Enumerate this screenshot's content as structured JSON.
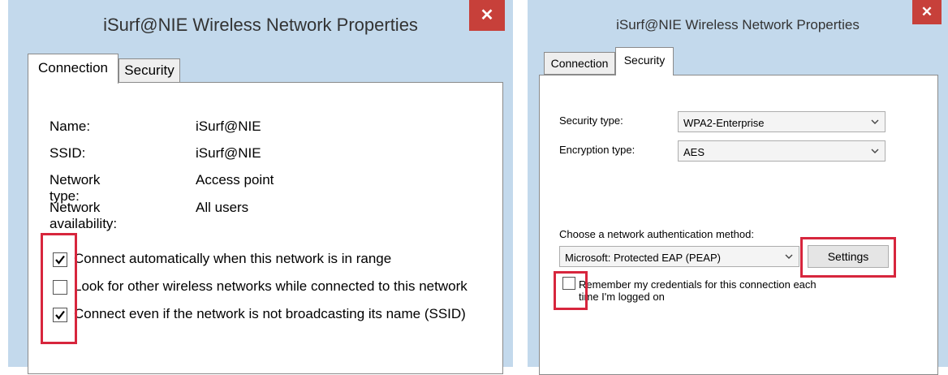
{
  "left_window": {
    "title": "iSurf@NIE Wireless Network Properties",
    "close_glyph": "✕",
    "tabs": [
      {
        "label": "Connection",
        "active": true
      },
      {
        "label": "Security",
        "active": false
      }
    ],
    "info": [
      {
        "label": "Name:",
        "value": "iSurf@NIE"
      },
      {
        "label": "SSID:",
        "value": "iSurf@NIE"
      },
      {
        "label": "Network type:",
        "value": "Access point"
      },
      {
        "label": "Network availability:",
        "value": "All users"
      }
    ],
    "checkboxes": [
      {
        "label": "Connect automatically when this network is in range",
        "checked": true
      },
      {
        "label": "Look for other wireless networks while connected to this network",
        "checked": false
      },
      {
        "label": "Connect even if the network is not broadcasting its name (SSID)",
        "checked": true
      }
    ]
  },
  "right_window": {
    "title": "iSurf@NIE Wireless Network Properties",
    "close_glyph": "✕",
    "tabs": [
      {
        "label": "Connection",
        "active": false
      },
      {
        "label": "Security",
        "active": true
      }
    ],
    "security_type_label": "Security type:",
    "security_type_value": "WPA2-Enterprise",
    "encryption_type_label": "Encryption type:",
    "encryption_type_value": "AES",
    "auth_method_label": "Choose a network authentication method:",
    "auth_method_value": "Microsoft: Protected EAP (PEAP)",
    "settings_button": "Settings",
    "remember_line1": "Remember my credentials for this connection each",
    "remember_line2": "time I'm logged on",
    "remember_checked": false
  },
  "colors": {
    "window_bg": "#c3d9ec",
    "close_button": "#c7403a",
    "highlight": "#d7263d"
  }
}
